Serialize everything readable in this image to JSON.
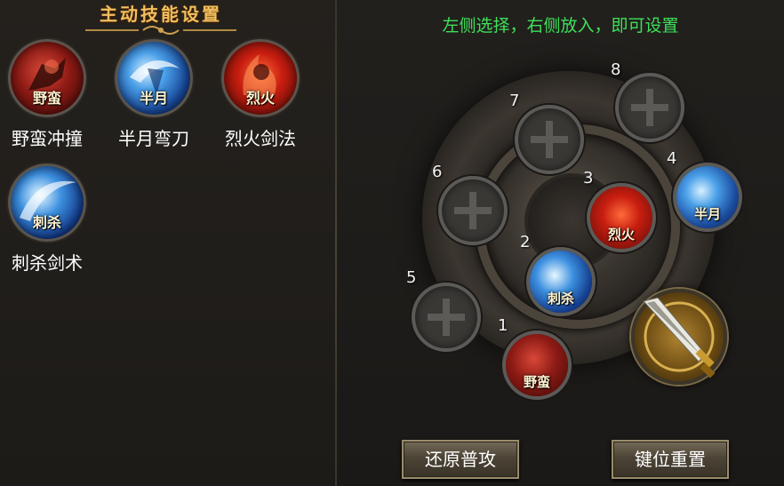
{
  "panel_title": "主动技能设置",
  "hint": "左侧选择，右侧放入，即可设置",
  "skills": [
    {
      "name": "野蛮冲撞",
      "tag": "野蛮",
      "icon": "savage-charge-icon"
    },
    {
      "name": "半月弯刀",
      "tag": "半月",
      "icon": "half-moon-blade-icon"
    },
    {
      "name": "烈火剑法",
      "tag": "烈火",
      "icon": "blazing-sword-icon"
    },
    {
      "name": "刺杀剑术",
      "tag": "刺杀",
      "icon": "assassinate-sword-icon"
    }
  ],
  "slots": [
    {
      "num": "1",
      "tag": "野蛮"
    },
    {
      "num": "2",
      "tag": "刺杀"
    },
    {
      "num": "3",
      "tag": "烈火"
    },
    {
      "num": "4",
      "tag": "半月"
    },
    {
      "num": "5",
      "tag": ""
    },
    {
      "num": "6",
      "tag": ""
    },
    {
      "num": "7",
      "tag": ""
    },
    {
      "num": "8",
      "tag": ""
    }
  ],
  "buttons": {
    "restore": "还原普攻",
    "reset": "键位重置"
  },
  "colors": {
    "hint": "#3ee05a",
    "title": "#f0c060"
  }
}
